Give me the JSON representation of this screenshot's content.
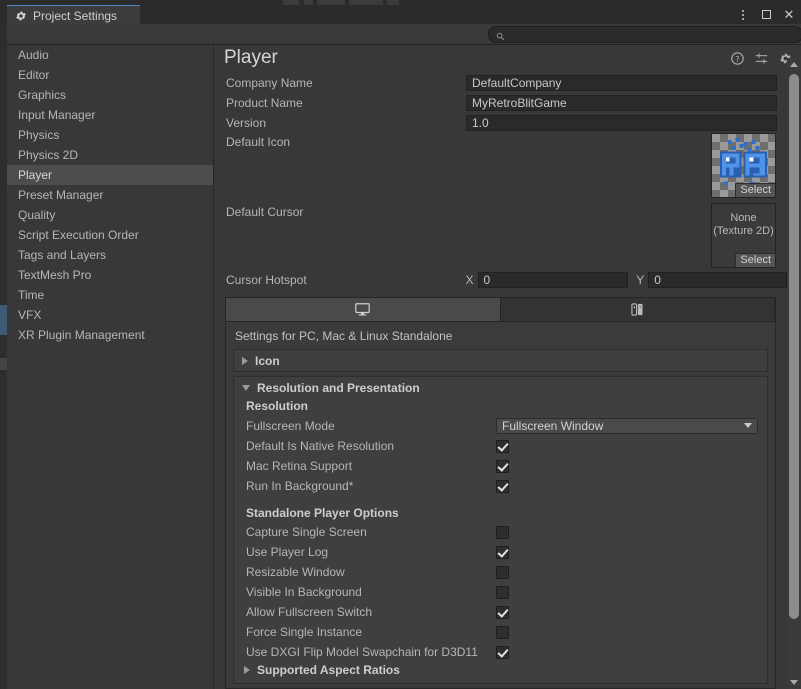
{
  "window": {
    "tab_label": "Project Settings",
    "tab_icon": "gear-icon",
    "controls": {
      "menu": "kebab-menu-icon",
      "maximize": "maximize-icon",
      "close": "close-icon"
    }
  },
  "search": {
    "placeholder": "",
    "value": "",
    "icon": "search-icon"
  },
  "sidebar": {
    "items": [
      {
        "label": "Audio",
        "selected": false
      },
      {
        "label": "Editor",
        "selected": false
      },
      {
        "label": "Graphics",
        "selected": false
      },
      {
        "label": "Input Manager",
        "selected": false
      },
      {
        "label": "Physics",
        "selected": false
      },
      {
        "label": "Physics 2D",
        "selected": false
      },
      {
        "label": "Player",
        "selected": true
      },
      {
        "label": "Preset Manager",
        "selected": false
      },
      {
        "label": "Quality",
        "selected": false
      },
      {
        "label": "Script Execution Order",
        "selected": false
      },
      {
        "label": "Tags and Layers",
        "selected": false
      },
      {
        "label": "TextMesh Pro",
        "selected": false
      },
      {
        "label": "Time",
        "selected": false
      },
      {
        "label": "VFX",
        "selected": false
      },
      {
        "label": "XR Plugin Management",
        "selected": false
      }
    ]
  },
  "panel": {
    "title": "Player",
    "header_icons": [
      "help-icon",
      "preset-icon",
      "gear-icon"
    ],
    "fields": {
      "company_name": {
        "label": "Company Name",
        "value": "DefaultCompany"
      },
      "product_name": {
        "label": "Product Name",
        "value": "MyRetroBlitGame"
      },
      "version": {
        "label": "Version",
        "value": "1.0"
      },
      "default_icon": {
        "label": "Default Icon",
        "select_label": "Select",
        "thumbnail": "rb-pixel-logo"
      },
      "default_cursor": {
        "label": "Default Cursor",
        "value_line1": "None",
        "value_line2": "(Texture 2D)",
        "select_label": "Select"
      },
      "cursor_hotspot": {
        "label": "Cursor Hotspot",
        "x_label": "X",
        "x_value": "0",
        "y_label": "Y",
        "y_value": "0"
      }
    },
    "platform_tabs": [
      {
        "icon": "monitor-icon",
        "active": true
      },
      {
        "icon": "console-icon",
        "active": false
      }
    ],
    "platform_caption": "Settings for PC, Mac & Linux Standalone",
    "sections": [
      {
        "title": "Icon",
        "expanded": false
      },
      {
        "title": "Resolution and Presentation",
        "expanded": true
      }
    ],
    "resolution": {
      "subhead": "Resolution",
      "fullscreen_mode": {
        "label": "Fullscreen Mode",
        "value": "Fullscreen Window"
      },
      "checkboxes": [
        {
          "label": "Default Is Native Resolution",
          "checked": true
        },
        {
          "label": "Mac Retina Support",
          "checked": true
        },
        {
          "label": "Run In Background*",
          "checked": true
        }
      ]
    },
    "standalone": {
      "subhead": "Standalone Player Options",
      "checkboxes": [
        {
          "label": "Capture Single Screen",
          "checked": false
        },
        {
          "label": "Use Player Log",
          "checked": true
        },
        {
          "label": "Resizable Window",
          "checked": false
        },
        {
          "label": "Visible In Background",
          "checked": false
        },
        {
          "label": "Allow Fullscreen Switch",
          "checked": true
        },
        {
          "label": "Force Single Instance",
          "checked": false
        },
        {
          "label": "Use DXGI Flip Model Swapchain for D3D11",
          "checked": true
        }
      ]
    },
    "cut_off_section": {
      "title": "Supported Aspect Ratios",
      "expanded": false
    }
  },
  "colors": {
    "background": "#383838",
    "panel": "#3b3b3b",
    "selection": "#4d4d4d",
    "accent": "#4e87c4",
    "icon_blue": "#3f7fd6",
    "text": "#b6b6b6"
  }
}
